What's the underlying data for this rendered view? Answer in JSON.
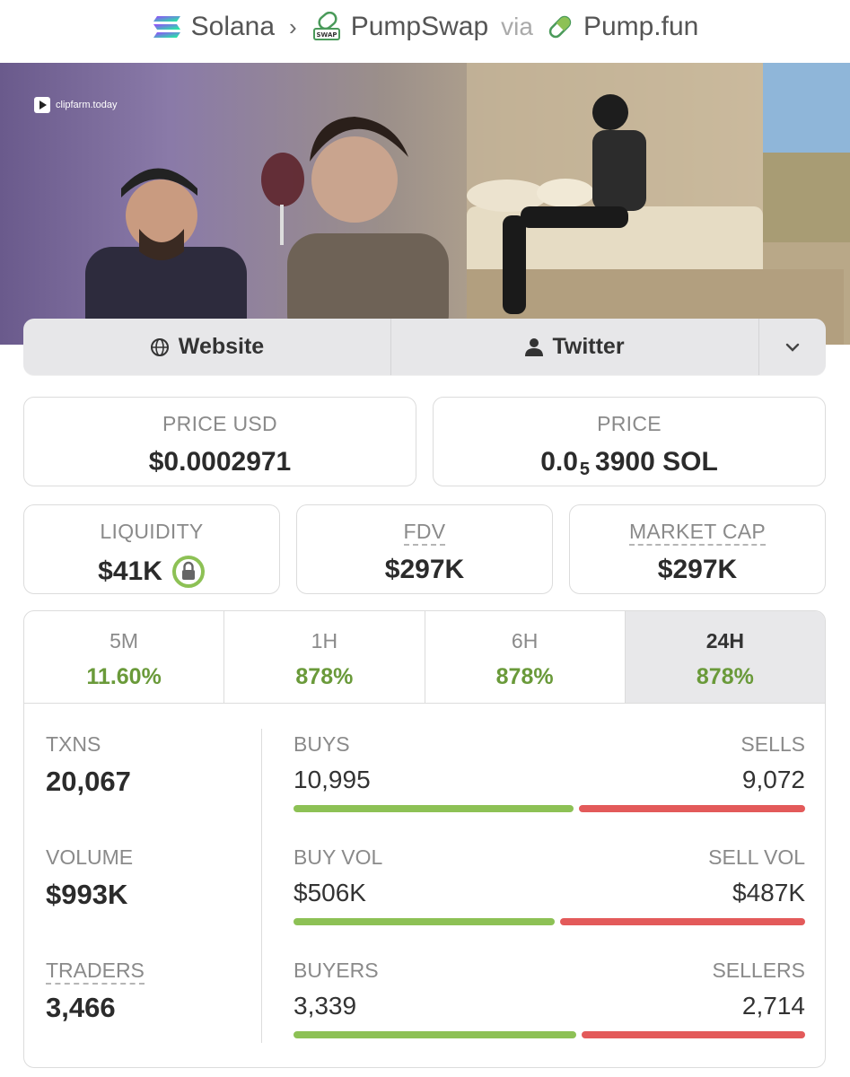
{
  "breadcrumb": {
    "chain": "Solana",
    "dex": "PumpSwap",
    "via": "via",
    "launchpad": "Pump.fun"
  },
  "banner": {
    "logo_text": "clipfarm.today"
  },
  "social": {
    "website": "Website",
    "twitter": "Twitter"
  },
  "price": {
    "usd_label": "PRICE USD",
    "usd_value": "$0.0002971",
    "native_label": "PRICE",
    "native_prefix": "0.0",
    "native_subscript": "5",
    "native_rest": "3900 SOL"
  },
  "metrics": {
    "liquidity_label": "LIQUIDITY",
    "liquidity_value": "$41K",
    "fdv_label": "FDV",
    "fdv_value": "$297K",
    "mcap_label": "MARKET CAP",
    "mcap_value": "$297K"
  },
  "timeframes": [
    {
      "label": "5M",
      "value": "11.60%"
    },
    {
      "label": "1H",
      "value": "878%"
    },
    {
      "label": "6H",
      "value": "878%"
    },
    {
      "label": "24H",
      "value": "878%"
    }
  ],
  "stats": {
    "txns_label": "TXNS",
    "txns_value": "20,067",
    "volume_label": "VOLUME",
    "volume_value": "$993K",
    "traders_label": "TRADERS",
    "traders_value": "3,466",
    "buys_label": "BUYS",
    "buys_value": "10,995",
    "sells_label": "SELLS",
    "sells_value": "9,072",
    "buys_fraction": 0.548,
    "buyvol_label": "BUY VOL",
    "buyvol_value": "$506K",
    "sellvol_label": "SELL VOL",
    "sellvol_value": "$487K",
    "buyvol_fraction": 0.51,
    "buyers_label": "BUYERS",
    "buyers_value": "3,339",
    "sellers_label": "SELLERS",
    "sellers_value": "2,714",
    "buyers_fraction": 0.552
  },
  "colors": {
    "positive": "#6a9a3a",
    "buy_bar": "#8dc155",
    "sell_bar": "#e35a5a",
    "lock_ring": "#8dc155"
  }
}
